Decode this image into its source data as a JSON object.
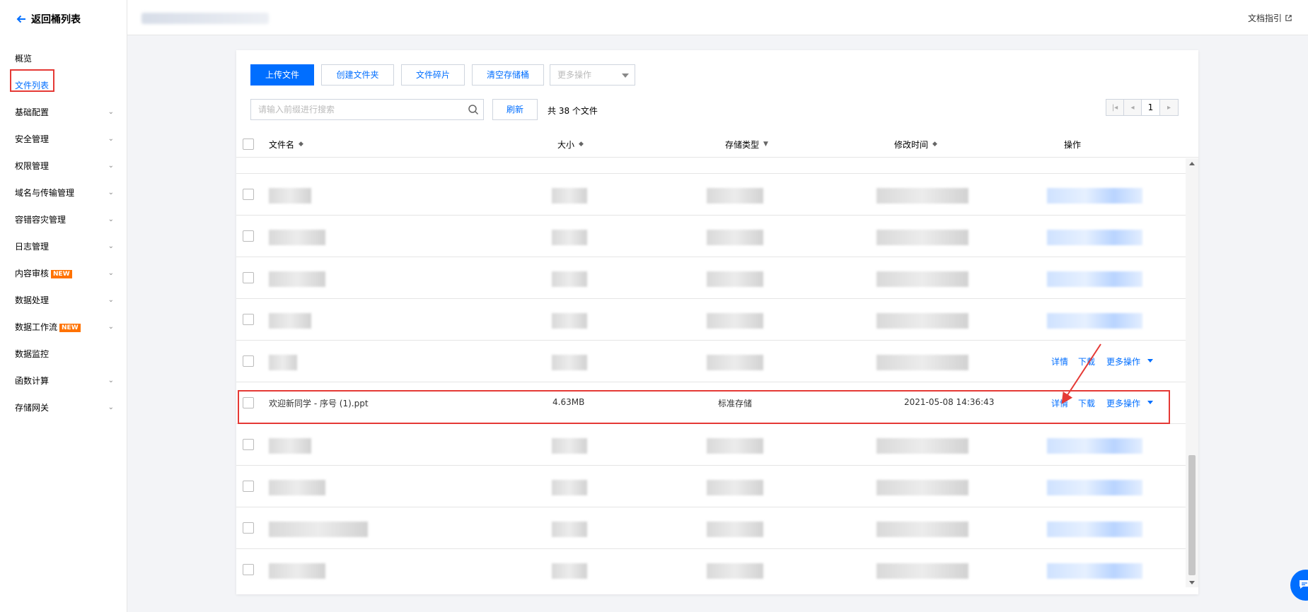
{
  "sidebar": {
    "back_label": "返回桶列表",
    "items": [
      {
        "label": "概览",
        "has_chevron": false,
        "active": false
      },
      {
        "label": "文件列表",
        "has_chevron": false,
        "active": true
      },
      {
        "label": "基础配置",
        "has_chevron": true
      },
      {
        "label": "安全管理",
        "has_chevron": true
      },
      {
        "label": "权限管理",
        "has_chevron": true
      },
      {
        "label": "域名与传输管理",
        "has_chevron": true
      },
      {
        "label": "容错容灾管理",
        "has_chevron": true
      },
      {
        "label": "日志管理",
        "has_chevron": true
      },
      {
        "label": "内容审核",
        "has_chevron": true,
        "badge": "NEW"
      },
      {
        "label": "数据处理",
        "has_chevron": true
      },
      {
        "label": "数据工作流",
        "has_chevron": true,
        "badge": "NEW"
      },
      {
        "label": "数据监控",
        "has_chevron": false
      },
      {
        "label": "函数计算",
        "has_chevron": true
      },
      {
        "label": "存储网关",
        "has_chevron": true
      }
    ]
  },
  "header": {
    "doc_link": "文档指引"
  },
  "toolbar": {
    "upload": "上传文件",
    "create_folder": "创建文件夹",
    "fragments": "文件碎片",
    "clear_bucket": "清空存储桶",
    "more_ops_placeholder": "更多操作",
    "search_placeholder": "请输入前缀进行搜索",
    "refresh": "刷新",
    "total": "共 38 个文件",
    "page": "1"
  },
  "table": {
    "columns": [
      "文件名",
      "大小",
      "存储类型",
      "修改时间",
      "操作"
    ],
    "highlighted_row": {
      "name": "欢迎新同学 - 序号 (1).ppt",
      "size": "4.63MB",
      "storage": "标准存储",
      "modified": "2021-05-08 14:36:43"
    },
    "actions": {
      "detail": "详情",
      "download": "下载",
      "more": "更多操作"
    }
  },
  "colors": {
    "accent": "#006eff",
    "highlight": "#e53935",
    "badge": "#ff7200"
  }
}
